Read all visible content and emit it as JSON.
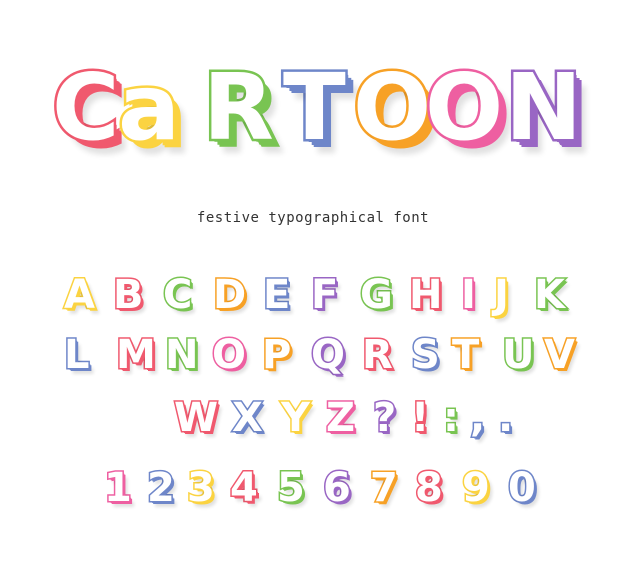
{
  "title": {
    "letters": [
      {
        "char": "C",
        "color": "#f0596e"
      },
      {
        "char": "a",
        "color": "#fbd341"
      },
      {
        "char": "R",
        "color": "#79c452"
      },
      {
        "char": "T",
        "color": "#6e86c9"
      },
      {
        "char": "O",
        "color": "#f7a126"
      },
      {
        "char": "O",
        "color": "#ee5fa1"
      },
      {
        "char": "N",
        "color": "#9966c4"
      }
    ]
  },
  "subtitle": "festive typographical font",
  "glyph_rows": [
    [
      {
        "char": "A",
        "color": "#fbd341"
      },
      {
        "char": "B",
        "color": "#f0596e"
      },
      {
        "char": "C",
        "color": "#79c452"
      },
      {
        "char": "D",
        "color": "#f7a126"
      },
      {
        "char": "E",
        "color": "#6e86c9"
      },
      {
        "char": "F",
        "color": "#9966c4"
      },
      {
        "char": "G",
        "color": "#79c452"
      },
      {
        "char": "H",
        "color": "#f0596e"
      },
      {
        "char": "I",
        "color": "#ee5fa1"
      },
      {
        "char": "J",
        "color": "#fbd341"
      },
      {
        "char": "K",
        "color": "#79c452"
      }
    ],
    [
      {
        "char": "L",
        "color": "#6e86c9"
      },
      {
        "char": "M",
        "color": "#f0596e"
      },
      {
        "char": "N",
        "color": "#79c452"
      },
      {
        "char": "O",
        "color": "#ee5fa1"
      },
      {
        "char": "P",
        "color": "#f7a126"
      },
      {
        "char": "Q",
        "color": "#9966c4"
      },
      {
        "char": "R",
        "color": "#f0596e"
      },
      {
        "char": "S",
        "color": "#6e86c9"
      },
      {
        "char": "T",
        "color": "#f7a126"
      },
      {
        "char": "U",
        "color": "#79c452"
      },
      {
        "char": "V",
        "color": "#f7a126"
      }
    ],
    [
      {
        "char": "W",
        "color": "#f0596e"
      },
      {
        "char": "X",
        "color": "#6e86c9"
      },
      {
        "char": "Y",
        "color": "#fbd341"
      },
      {
        "char": "Z",
        "color": "#ee5fa1"
      },
      {
        "char": "?",
        "color": "#9966c4"
      },
      {
        "char": "!",
        "color": "#f0596e"
      },
      {
        "char": ":",
        "color": "#79c452"
      },
      {
        "char": ",",
        "color": "#6e86c9"
      },
      {
        "char": ".",
        "color": "#6e86c9"
      }
    ],
    [
      {
        "char": "1",
        "color": "#ee5fa1"
      },
      {
        "char": "2",
        "color": "#6e86c9"
      },
      {
        "char": "3",
        "color": "#fbd341"
      },
      {
        "char": "4",
        "color": "#f0596e"
      },
      {
        "char": "5",
        "color": "#79c452"
      },
      {
        "char": "6",
        "color": "#9966c4"
      },
      {
        "char": "7",
        "color": "#f7a126"
      },
      {
        "char": "8",
        "color": "#f0596e"
      },
      {
        "char": "9",
        "color": "#fbd341"
      },
      {
        "char": "0",
        "color": "#6e86c9"
      }
    ]
  ]
}
